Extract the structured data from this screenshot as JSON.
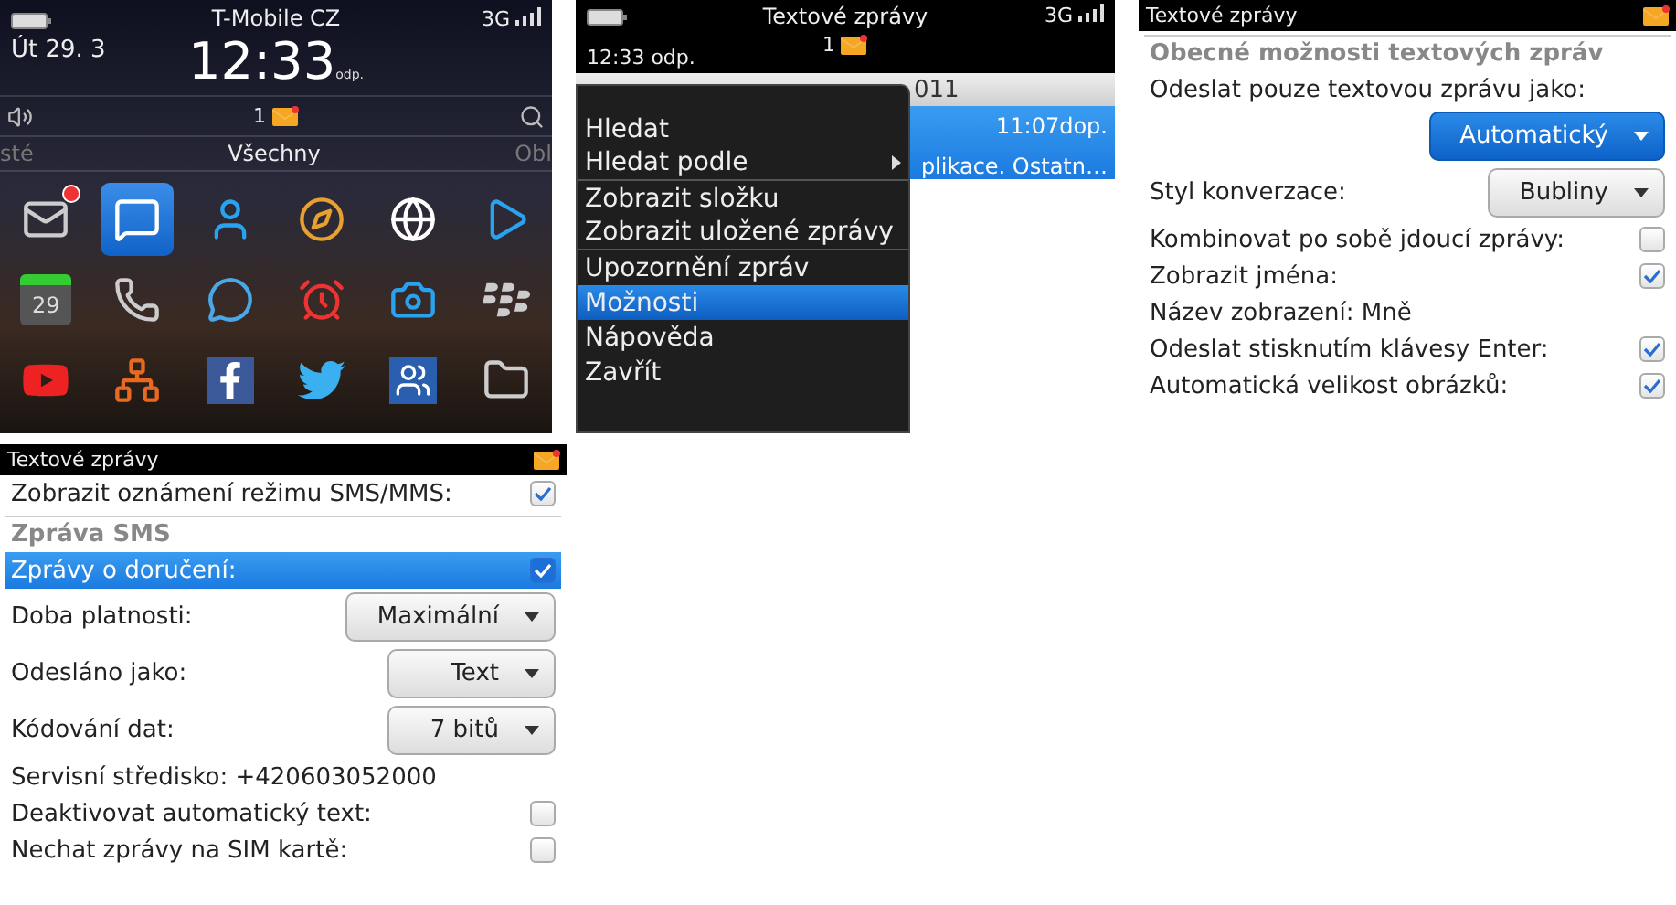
{
  "home_screen": {
    "status": {
      "date": "Út 29. 3",
      "carrier": "T-Mobile CZ",
      "time": "12:33",
      "time_suffix": "odp.",
      "network": "3G"
    },
    "notifications": {
      "unread_count": "1"
    },
    "tabs": [
      {
        "label": "sté",
        "selected": false
      },
      {
        "label": "Všechny",
        "selected": true
      },
      {
        "label": "Obl",
        "selected": false
      }
    ],
    "apps": [
      {
        "kind": "mail",
        "selected": false,
        "badge": true
      },
      {
        "kind": "messages",
        "selected": true
      },
      {
        "kind": "contacts",
        "selected": false
      },
      {
        "kind": "browser",
        "selected": false
      },
      {
        "kind": "maps",
        "selected": false
      },
      {
        "kind": "media",
        "selected": false
      },
      {
        "kind": "calendar",
        "selected": false,
        "day": "29"
      },
      {
        "kind": "phone",
        "selected": false
      },
      {
        "kind": "chat",
        "selected": false
      },
      {
        "kind": "alarm",
        "selected": false
      },
      {
        "kind": "camera",
        "selected": false
      },
      {
        "kind": "blackberry",
        "selected": false
      },
      {
        "kind": "youtube",
        "selected": false
      },
      {
        "kind": "network",
        "selected": false
      },
      {
        "kind": "facebook",
        "selected": false
      },
      {
        "kind": "twitter",
        "selected": false
      },
      {
        "kind": "social",
        "selected": false
      },
      {
        "kind": "folder",
        "selected": false
      }
    ]
  },
  "messages_screen": {
    "header": {
      "title": "Textové zprávy",
      "time": "12:33 odp.",
      "network": "3G",
      "unread_count": "1"
    },
    "list": {
      "date_header": "011",
      "item_time": "11:07dop.",
      "item_preview": "plikace. Ostatn…"
    },
    "menu": [
      {
        "label": "Hledat",
        "selected": false,
        "submenu": false,
        "separator_after": false
      },
      {
        "label": "Hledat podle",
        "selected": false,
        "submenu": true,
        "separator_after": true
      },
      {
        "label": "Zobrazit složku",
        "selected": false,
        "submenu": false,
        "separator_after": false
      },
      {
        "label": "Zobrazit uložené zprávy",
        "selected": false,
        "submenu": false,
        "separator_after": true
      },
      {
        "label": "Upozornění zpráv",
        "selected": false,
        "submenu": false,
        "separator_after": false
      },
      {
        "label": "Možnosti",
        "selected": true,
        "submenu": false,
        "separator_after": false
      },
      {
        "label": "Nápověda",
        "selected": false,
        "submenu": false,
        "separator_after": false
      },
      {
        "label": "Zavřít",
        "selected": false,
        "submenu": false,
        "separator_after": false
      }
    ]
  },
  "options_screen": {
    "title": "Textové zprávy",
    "rows": [
      {
        "kind": "section",
        "label": "Obecné možnosti textových zpráv",
        "selected": false
      },
      {
        "kind": "text",
        "label": "Odeslat pouze textovou zprávu jako:",
        "selected": false
      },
      {
        "kind": "dropdown",
        "value": "Automatický",
        "selected": true
      },
      {
        "kind": "dropdown",
        "label": "Styl konverzace:",
        "value": "Bubliny",
        "selected": false
      },
      {
        "kind": "checkbox",
        "label": "Kombinovat po sobě jdoucí zprávy:",
        "checked": false,
        "selected": false
      },
      {
        "kind": "checkbox",
        "label": "Zobrazit jména:",
        "checked": true,
        "selected": false
      },
      {
        "kind": "text",
        "label": "Název zobrazení: Mně",
        "selected": false
      },
      {
        "kind": "checkbox",
        "label": "Odeslat stisknutím klávesy Enter:",
        "checked": true,
        "selected": false
      },
      {
        "kind": "checkbox",
        "label": "Automatická velikost obrázků:",
        "checked": true,
        "selected": false
      }
    ]
  },
  "sms_options_screen": {
    "title": "Textové zprávy",
    "rows": [
      {
        "kind": "checkbox",
        "label": "Zobrazit oznámení režimu SMS/MMS:",
        "checked": true,
        "selected": false
      },
      {
        "kind": "section",
        "label": "Zpráva SMS",
        "selected": false
      },
      {
        "kind": "checkbox",
        "label": "Zprávy o doručení:",
        "checked": true,
        "selected": true
      },
      {
        "kind": "dropdown",
        "label": "Doba platnosti:",
        "value": "Maximální",
        "selected": false
      },
      {
        "kind": "dropdown",
        "label": "Odesláno jako:",
        "value": "Text",
        "selected": false
      },
      {
        "kind": "dropdown",
        "label": "Kódování dat:",
        "value": "7 bitů",
        "selected": false
      },
      {
        "kind": "text",
        "label": "Servisní středisko: +420603052000",
        "selected": false
      },
      {
        "kind": "checkbox",
        "label": "Deaktivovat automatický text:",
        "checked": false,
        "selected": false
      },
      {
        "kind": "checkbox",
        "label": "Nechat zprávy na SIM kartě:",
        "checked": false,
        "selected": false
      }
    ]
  }
}
